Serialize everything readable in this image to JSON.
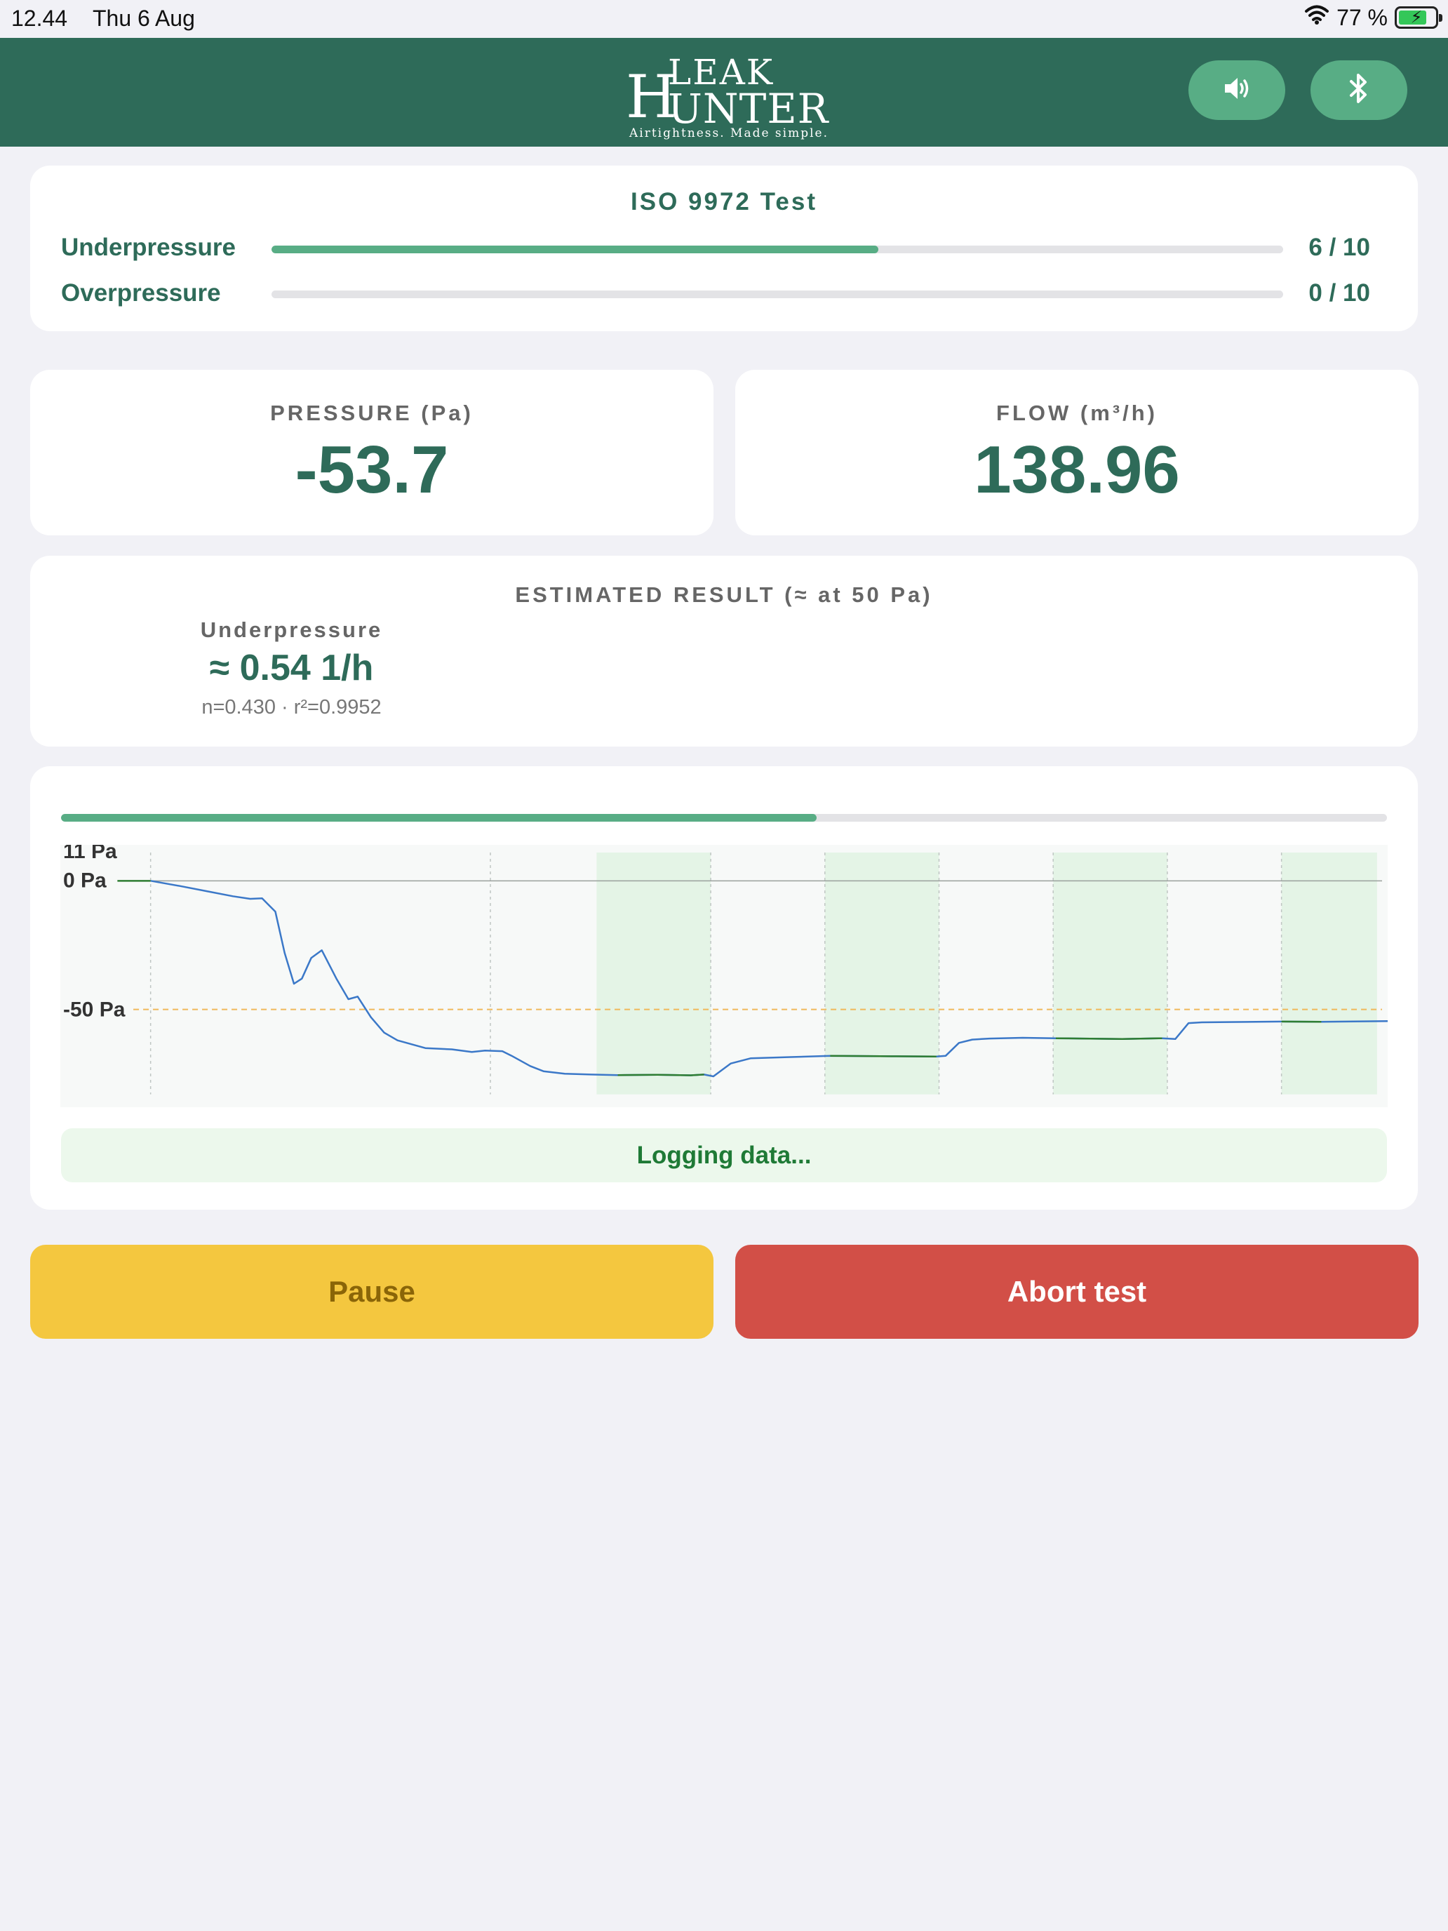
{
  "status_bar": {
    "time": "12.44",
    "date": "Thu 6 Aug",
    "battery": "77 %",
    "battery_level": 0.77
  },
  "header": {
    "logo": {
      "h": "H",
      "leak": "LEAK",
      "unter": "UNTER",
      "tagline": "Airtightness. Made simple."
    },
    "sound_icon": "speaker-icon",
    "bluetooth_icon": "bluetooth-icon",
    "brand_color": "#2e6b59",
    "button_color": "#58ad85"
  },
  "test": {
    "title": "ISO 9972 Test",
    "underpressure": {
      "label": "Underpressure",
      "count": "6 / 10",
      "progress": 0.6
    },
    "overpressure": {
      "label": "Overpressure",
      "count": "0 / 10",
      "progress": 0
    }
  },
  "pressure": {
    "label": "PRESSURE (Pa)",
    "value": "-53.7"
  },
  "flow": {
    "label": "FLOW (m³/h)",
    "value": "138.96"
  },
  "estimate": {
    "title": "ESTIMATED RESULT (≈ at 50 Pa)",
    "mode": "Underpressure",
    "value": "≈ 0.54 1/h",
    "stats": "n=0.430 · r²=0.9952"
  },
  "chart_progress": 0.57,
  "status_message": "Logging data...",
  "buttons": {
    "pause": "Pause",
    "abort": "Abort test"
  },
  "chart_data": {
    "type": "line",
    "yticks": [
      "11 Pa",
      "0 Pa",
      "-50 Pa"
    ],
    "ylim": [
      -88,
      14
    ],
    "xlim": [
      0,
      100
    ],
    "reference_lines": [
      {
        "y": 0,
        "style": "solid"
      },
      {
        "y": -50,
        "style": "dashed",
        "color": "#f0b85a"
      }
    ],
    "grid": "vertical dashed",
    "logging_bands": [
      [
        40.4,
        49.0
      ],
      [
        57.6,
        66.2
      ],
      [
        74.8,
        83.4
      ],
      [
        92.0,
        99.2
      ]
    ],
    "series": [
      {
        "color": "#3b78c8",
        "x": [
          6.8,
          9,
          11,
          13,
          14.3,
          15.2,
          16.2,
          16.9,
          17.6,
          18.2,
          18.9,
          19.7,
          20.8,
          21.7,
          22.4,
          23.4,
          24.4,
          25.4,
          27.5,
          29.5,
          31,
          32,
          33.3,
          34,
          35.4,
          36.4,
          38,
          40,
          42,
          45,
          47.5,
          48.5,
          49.2,
          50.5,
          52,
          55,
          58,
          60,
          63,
          66,
          66.7,
          67.7,
          68.7,
          70,
          72.5,
          75,
          77,
          80,
          83,
          84,
          85,
          86,
          88,
          92,
          95,
          100
        ],
        "y": [
          0,
          -2,
          -4,
          -6,
          -7,
          -6.8,
          -12,
          -28,
          -40,
          -38,
          -30,
          -27,
          -38,
          -46,
          -45,
          -53,
          -59,
          -62,
          -65,
          -65.5,
          -66.5,
          -66,
          -66.2,
          -68,
          -72,
          -74,
          -75,
          -75.3,
          -75.5,
          -75.4,
          -75.6,
          -75.3,
          -76,
          -71,
          -69,
          -68.5,
          -68,
          -68.1,
          -68.2,
          -68.3,
          -68,
          -63,
          -61.7,
          -61.3,
          -61,
          -61.2,
          -61.3,
          -61.5,
          -61.2,
          -61.5,
          -55.3,
          -55,
          -54.9,
          -54.7,
          -54.8,
          -54.5
        ]
      }
    ]
  }
}
